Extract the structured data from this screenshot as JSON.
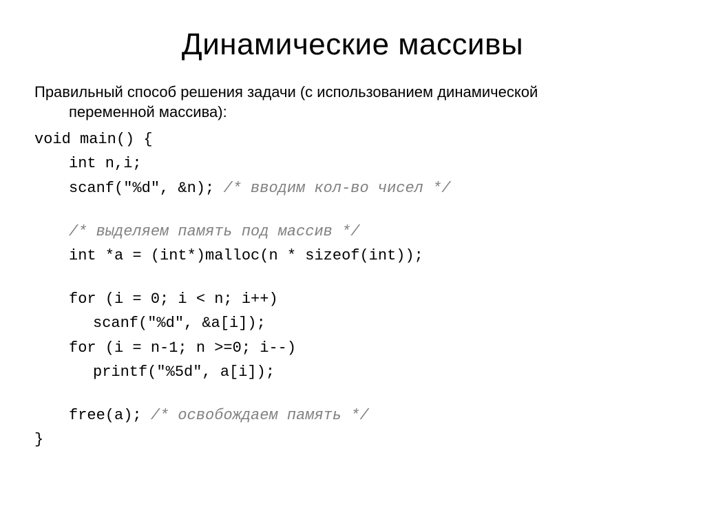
{
  "title": "Динамические массивы",
  "intro_line1": "Правильный способ решения задачи (с использованием динамической",
  "intro_line2": "переменной массива):",
  "code": {
    "l1": "void main() {",
    "l2": "int n,i;",
    "l3a": "scanf(\"%d\", &n); ",
    "l3b": "/* вводим кол-во чисел */",
    "l4": "/* выделяем память под массив */",
    "l5": "int *a = (int*)malloc(n * sizeof(int));",
    "l6": "for (i = 0; i < n; i++)",
    "l7": "scanf(\"%d\", &a[i]);",
    "l8": "for (i = n-1; n >=0; i--)",
    "l9": "printf(\"%5d\", a[i]);",
    "l10a": "free(a); ",
    "l10b": "/* освобождаем память */",
    "l11": "}"
  }
}
